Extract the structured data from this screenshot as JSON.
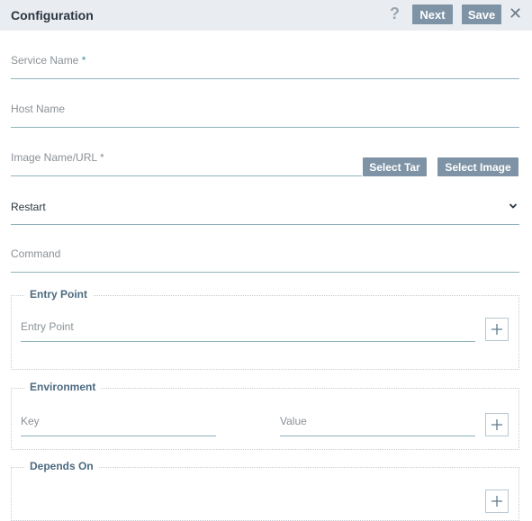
{
  "header": {
    "title": "Configuration",
    "help_icon": "help-icon",
    "next_label": "Next",
    "save_label": "Save",
    "close_icon": "close-icon"
  },
  "form": {
    "service_name": {
      "label": "Service Name",
      "required_mark": "*",
      "value": ""
    },
    "host_name": {
      "label": "Host Name",
      "value": ""
    },
    "image_name": {
      "label": "Image Name/URL",
      "required_mark": "*",
      "value": ""
    },
    "select_tar_label": "Select Tar",
    "select_image_label": "Select Image",
    "restart": {
      "value": "Restart",
      "icon": "chevron-down-icon"
    },
    "command": {
      "label": "Command",
      "value": ""
    }
  },
  "entry_point": {
    "title": "Entry Point",
    "field_label": "Entry Point",
    "add_icon": "plus-icon"
  },
  "environment": {
    "title": "Environment",
    "key_label": "Key",
    "value_label": "Value",
    "add_icon": "plus-icon"
  },
  "depends_on": {
    "title": "Depends On"
  },
  "colors": {
    "header_bg": "#e9edf1",
    "button_bg": "#7e93a5",
    "underline": "#8fb3bb",
    "group_title": "#4c6a80"
  }
}
